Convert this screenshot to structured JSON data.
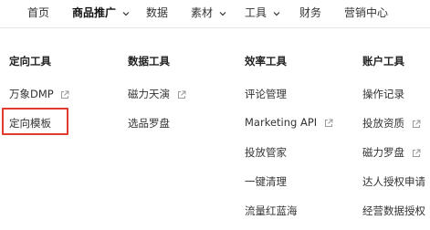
{
  "topnav": {
    "items": [
      {
        "label": "首页",
        "active": false,
        "dropdown": false
      },
      {
        "label": "商品推广",
        "active": true,
        "dropdown": true
      },
      {
        "label": "数据",
        "active": false,
        "dropdown": false
      },
      {
        "label": "素材",
        "active": false,
        "dropdown": true
      },
      {
        "label": "工具",
        "active": false,
        "dropdown": true
      },
      {
        "label": "财务",
        "active": false,
        "dropdown": false
      },
      {
        "label": "营销中心",
        "active": false,
        "dropdown": false
      }
    ]
  },
  "menu": {
    "columns": [
      {
        "title": "定向工具",
        "items": [
          {
            "label": "万象DMP",
            "external": true
          },
          {
            "label": "定向模板",
            "external": false,
            "highlighted": true
          }
        ]
      },
      {
        "title": "数据工具",
        "items": [
          {
            "label": "磁力天演",
            "external": true
          },
          {
            "label": "选品罗盘",
            "external": false
          }
        ]
      },
      {
        "title": "效率工具",
        "items": [
          {
            "label": "评论管理",
            "external": false
          },
          {
            "label": "Marketing API",
            "external": true
          },
          {
            "label": "投放管家",
            "external": false
          },
          {
            "label": "一键清理",
            "external": false
          },
          {
            "label": "流量红蓝海",
            "external": false
          }
        ]
      },
      {
        "title": "账户工具",
        "items": [
          {
            "label": "操作记录",
            "external": false
          },
          {
            "label": "投放资质",
            "external": true
          },
          {
            "label": "磁力罗盘",
            "external": true
          },
          {
            "label": "达人授权申请",
            "external": false
          },
          {
            "label": "经营数据授权",
            "external": false
          }
        ]
      }
    ]
  },
  "colors": {
    "highlight": "#e23b2e",
    "text": "#333333",
    "icon": "#9a9a9a"
  },
  "icons": {
    "external": "external-link-icon",
    "dropdown": "chevron-down-icon"
  }
}
